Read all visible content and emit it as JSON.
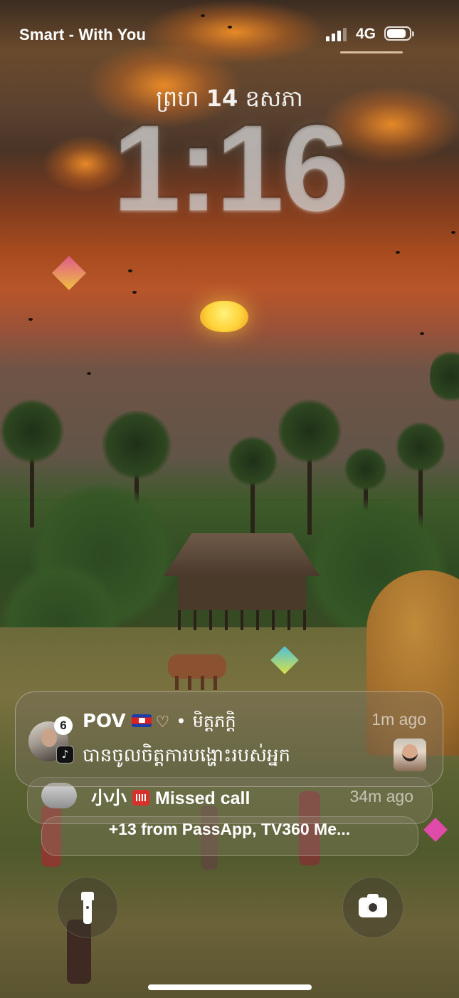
{
  "status_bar": {
    "carrier": "Smart - With You",
    "network": "4G",
    "signal_bars": 3,
    "signal_bars_total": 4,
    "battery_level": 0.85
  },
  "lock_screen": {
    "date_prefix": "ព្រហ",
    "date_day": "14",
    "date_month": "ឧសភា",
    "time": "1:16"
  },
  "notifications": [
    {
      "app_icon": "tiktok-icon",
      "badge": "6",
      "title": "POV",
      "emoji_icons": [
        "cambodia-flag-icon",
        "heart-hands-icon"
      ],
      "separator": "•",
      "subtitle": "មិត្តភក្តិ",
      "time": "1m ago",
      "body": "បានចូលចិត្តការបង្ហោះរបស់អ្នក"
    },
    {
      "app_icon": "telegram-icon",
      "title": "小小",
      "emoji_icons": [
        "telephone-receiver-icon"
      ],
      "body": "Missed call",
      "time": "34m ago"
    }
  ],
  "more_notifications": "+13 from PassApp, TV360 Me...",
  "controls": {
    "left": "flashlight-icon",
    "right": "camera-icon"
  },
  "colors": {
    "glass": "#786e5f",
    "time_text": "#e1e1e1",
    "missed_call_red": "#d8312c",
    "telegram_blue": "#2aa3e0"
  }
}
